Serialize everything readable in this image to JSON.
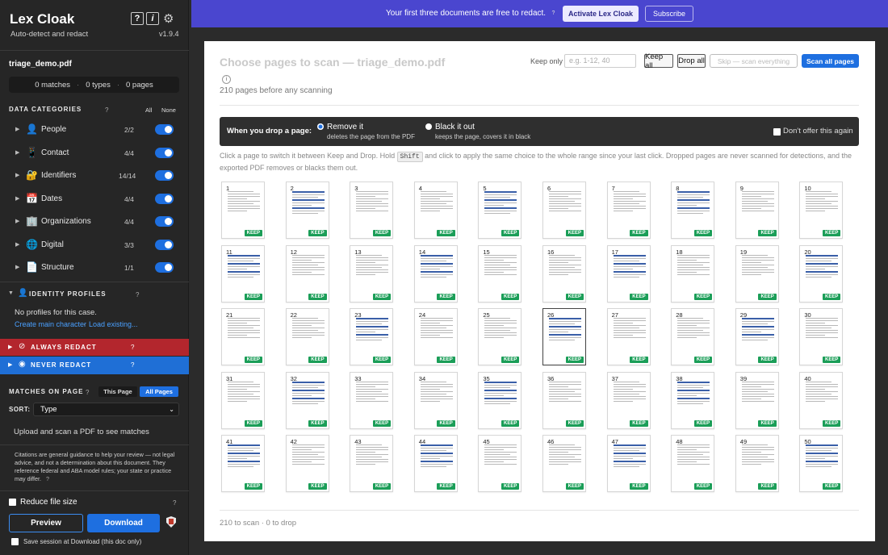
{
  "app": {
    "name": "Lex Cloak",
    "tagline": "Auto-detect and redact",
    "version": "v1.9.4",
    "help_btn": "?",
    "info_btn": "i"
  },
  "doc": {
    "filename": "triage_demo.pdf",
    "matches": "0 matches",
    "types": "0 types",
    "pages": "0 pages"
  },
  "categories_section": {
    "title": "DATA CATEGORIES",
    "q": "?",
    "all": "All",
    "none": "None"
  },
  "categories": [
    {
      "label": "People",
      "count": "2/2",
      "icon": "person-icon"
    },
    {
      "label": "Contact",
      "count": "4/4",
      "icon": "phone-icon"
    },
    {
      "label": "Identifiers",
      "count": "14/14",
      "icon": "id-icon"
    },
    {
      "label": "Dates",
      "count": "4/4",
      "icon": "calendar-icon"
    },
    {
      "label": "Organizations",
      "count": "4/4",
      "icon": "building-icon"
    },
    {
      "label": "Digital",
      "count": "3/3",
      "icon": "globe-icon"
    },
    {
      "label": "Structure",
      "count": "1/1",
      "icon": "document-icon"
    }
  ],
  "identity": {
    "title": "IDENTITY PROFILES",
    "q": "?",
    "empty": "No profiles for this case.",
    "create": "Create main character",
    "sep": "·",
    "load": "Load existing..."
  },
  "always": {
    "label": "ALWAYS REDACT",
    "q": "?"
  },
  "never": {
    "label": "NEVER REDACT",
    "q": "?"
  },
  "matches": {
    "title": "MATCHES ON PAGE",
    "q": "?",
    "this_page": "This Page",
    "all_pages": "All Pages",
    "sort_label": "SORT:",
    "sort_value": "Type",
    "empty": "Upload and scan a PDF to see matches"
  },
  "disclaimer": "Citations are general guidance to help your review — not legal advice, and not a determination about this document. They reference federal and ABA model rules; your state or practice may differ.",
  "disclaimer_q": "?",
  "footer": {
    "reduce": "Reduce file size",
    "reduce_q": "?",
    "preview": "Preview",
    "download": "Download",
    "save_session": "Save session at Download (this doc only)"
  },
  "banner": {
    "text": "Your first three documents are free to redact.",
    "q": "?",
    "activate": "Activate Lex Cloak",
    "subscribe": "Subscribe"
  },
  "panel": {
    "title": "Choose pages to scan — triage_demo.pdf",
    "info": "i",
    "subtitle": "210 pages before any scanning",
    "keep_only": "Keep only",
    "range_placeholder": "e.g. 1-12, 40",
    "keep_all": "Keep all",
    "drop_all": "Drop all",
    "skip": "Skip — scan everything",
    "scan_all": "Scan all pages",
    "drop_label": "When you drop a page:",
    "remove_title": "Remove it",
    "remove_sub": "deletes the page from the PDF",
    "black_title": "Black it out",
    "black_sub": "keeps the page, covers it in black",
    "dont_offer": "Don't offer this again",
    "help_a": "Click a page to switch it between Keep and Drop. Hold",
    "help_key": "Shift",
    "help_b": "and click to apply the same choice to the whole range since your last click. Dropped pages are never scanned for detections, and the exported PDF removes or blacks them out.",
    "keep_badge": "KEEP",
    "footer": "210 to scan · 0 to drop"
  },
  "pages": [
    "1",
    "2",
    "3",
    "4",
    "5",
    "6",
    "7",
    "8",
    "9",
    "10",
    "11",
    "12",
    "13",
    "14",
    "15",
    "16",
    "17",
    "18",
    "19",
    "20",
    "21",
    "22",
    "23",
    "24",
    "25",
    "26",
    "27",
    "28",
    "29",
    "30",
    "31",
    "32",
    "33",
    "34",
    "35",
    "36",
    "37",
    "38",
    "39",
    "40",
    "41",
    "42",
    "43",
    "44",
    "45",
    "46",
    "47",
    "48",
    "49",
    "50"
  ],
  "current_page": "26",
  "colors": {
    "accent": "#1e6fe0",
    "always": "#b3262d",
    "keep": "#1b9e58",
    "banner": "#4a46cf"
  }
}
